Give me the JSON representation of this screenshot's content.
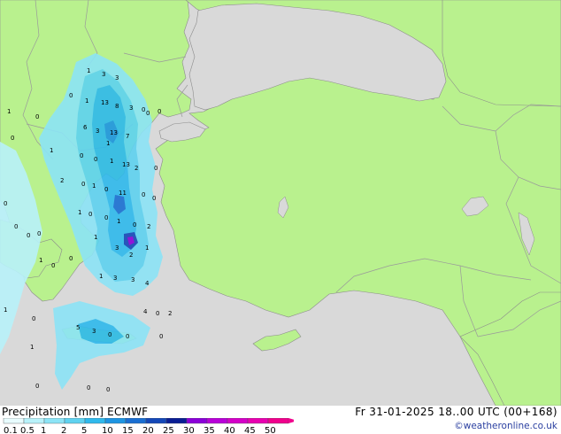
{
  "title": "Precipitation [mm]  ECMWF",
  "datetime": "Fr 31-01-2025 18..00 UTC (00+168)",
  "credit": "©weatheronline.co.uk",
  "colors": {
    "land": "#b9f18e",
    "sea": "#d9d9d9",
    "border": "#9a9a9a",
    "coast": "#8c8c8c"
  },
  "legend": {
    "labels": [
      "0.1",
      "0.5",
      "1",
      "2",
      "5",
      "10",
      "15",
      "20",
      "25",
      "30",
      "35",
      "40",
      "45",
      "50"
    ],
    "colors": [
      "#e8fcfe",
      "#b8f2fa",
      "#8ce4f6",
      "#5fd2f0",
      "#2fb9ec",
      "#1e95e2",
      "#1a6fd2",
      "#1448b8",
      "#0a1e94",
      "#8a00d8",
      "#b800d8",
      "#d400c8",
      "#e800b0",
      "#f0008c"
    ]
  },
  "map_numbers": [
    "1",
    "3",
    "3",
    "0",
    "1",
    "13",
    "8",
    "3",
    "0",
    "0",
    "0",
    "1",
    "6",
    "3",
    "13",
    "7",
    "1",
    "0",
    "0",
    "1",
    "0",
    "0",
    "13",
    "1",
    "2",
    "0",
    "2",
    "0",
    "1",
    "0",
    "11",
    "0",
    "0",
    "0",
    "1",
    "0",
    "0",
    "1",
    "0",
    "2",
    "3",
    "2",
    "1",
    "3",
    "1",
    "3",
    "4",
    "0",
    "0",
    "1",
    "0",
    "0",
    "0",
    "1",
    "0",
    "2",
    "4",
    "5",
    "3",
    "0",
    "0",
    "0",
    "1",
    "1",
    "0",
    "0",
    "0",
    "0"
  ]
}
